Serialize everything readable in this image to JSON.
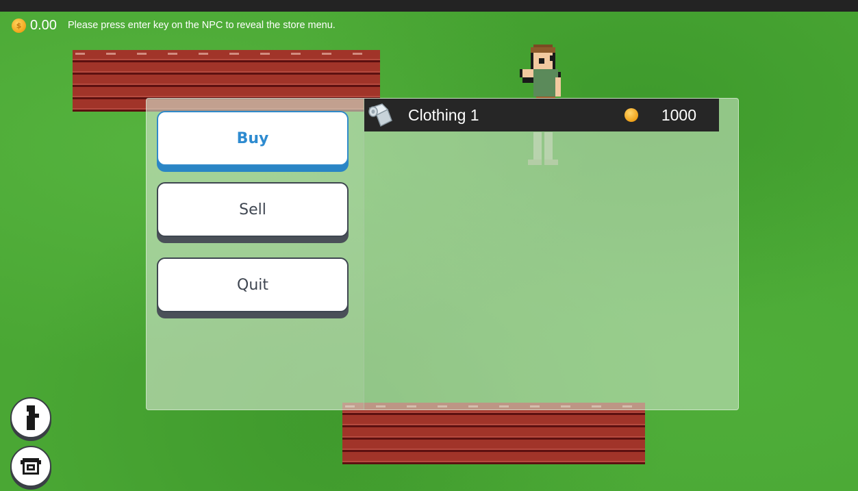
{
  "hud": {
    "coin_icon": "coin-icon",
    "money": "0.00",
    "hint": "Please press enter key on the NPC to reveal the store menu."
  },
  "store": {
    "menu": {
      "buy_label": "Buy",
      "sell_label": "Sell",
      "quit_label": "Quit",
      "selected": "Buy"
    },
    "items": [
      {
        "icon": "cloth-roll-icon",
        "name": "Clothing 1",
        "price": "1000",
        "price_icon": "coin-icon"
      }
    ]
  },
  "side_buttons": [
    {
      "icon": "character-icon"
    },
    {
      "icon": "inventory-chest-icon"
    }
  ],
  "colors": {
    "grass": "#4aa734",
    "accent_blue": "#2e8bd0",
    "item_row_bg": "#262626",
    "coin": "#f0a21a"
  }
}
